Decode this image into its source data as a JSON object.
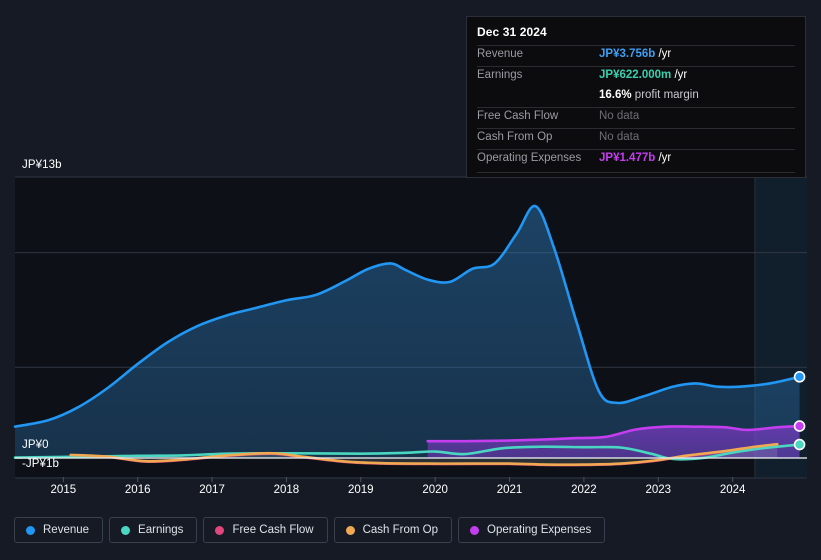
{
  "axes": {
    "y_top_label": "JP¥13b",
    "y_zero_label": "JP¥0",
    "y_bottom_label": "-JP¥1b",
    "x_labels": [
      "2015",
      "2016",
      "2017",
      "2018",
      "2019",
      "2020",
      "2021",
      "2022",
      "2023",
      "2024"
    ]
  },
  "tooltip": {
    "date": "Dec 31 2024",
    "rows": [
      {
        "label": "Revenue",
        "amount": "JP¥3.756b",
        "unit": "/yr",
        "color": "#3e9ff2",
        "nodata": false
      },
      {
        "label": "Earnings",
        "amount": "JP¥622.000m",
        "unit": "/yr",
        "color": "#39cfae",
        "nodata": false
      },
      {
        "label": "",
        "amount": "16.6%",
        "unit": "profit margin",
        "color": "#ffffff",
        "nodata": false
      },
      {
        "label": "Free Cash Flow",
        "amount": "No data",
        "unit": "",
        "color": "#6e6e76",
        "nodata": true
      },
      {
        "label": "Cash From Op",
        "amount": "No data",
        "unit": "",
        "color": "#6e6e76",
        "nodata": true
      },
      {
        "label": "Operating Expenses",
        "amount": "JP¥1.477b",
        "unit": "/yr",
        "color": "#c43ef0",
        "nodata": false
      }
    ]
  },
  "legend": [
    {
      "label": "Revenue",
      "color": "#2196f3"
    },
    {
      "label": "Earnings",
      "color": "#4ad6c0"
    },
    {
      "label": "Free Cash Flow",
      "color": "#e0467c"
    },
    {
      "label": "Cash From Op",
      "color": "#f0a952"
    },
    {
      "label": "Operating Expenses",
      "color": "#c43ef0"
    }
  ],
  "chart_data": {
    "type": "area",
    "title": "",
    "xlabel": "",
    "ylabel": "JP¥",
    "currency": "JP¥",
    "xlim": [
      2014.35,
      2025.0
    ],
    "ylim": [
      -1.0,
      13.0
    ],
    "y_ticks": [
      13,
      9.5,
      4.2,
      0,
      -1
    ],
    "grid": true,
    "legend_position": "bottom",
    "forecast_start": 2024.3,
    "series": [
      {
        "name": "Revenue",
        "color": "#2196f3",
        "fill": true,
        "points": [
          [
            2014.35,
            1.45
          ],
          [
            2014.8,
            1.75
          ],
          [
            2015.2,
            2.35
          ],
          [
            2015.6,
            3.25
          ],
          [
            2016.0,
            4.35
          ],
          [
            2016.4,
            5.35
          ],
          [
            2016.8,
            6.1
          ],
          [
            2017.2,
            6.6
          ],
          [
            2017.6,
            6.95
          ],
          [
            2018.0,
            7.3
          ],
          [
            2018.4,
            7.55
          ],
          [
            2018.8,
            8.2
          ],
          [
            2019.1,
            8.75
          ],
          [
            2019.4,
            9.0
          ],
          [
            2019.6,
            8.7
          ],
          [
            2019.9,
            8.25
          ],
          [
            2020.2,
            8.15
          ],
          [
            2020.5,
            8.75
          ],
          [
            2020.8,
            9.0
          ],
          [
            2021.1,
            10.4
          ],
          [
            2021.35,
            11.65
          ],
          [
            2021.6,
            9.7
          ],
          [
            2021.9,
            6.3
          ],
          [
            2022.2,
            3.1
          ],
          [
            2022.45,
            2.55
          ],
          [
            2022.8,
            2.85
          ],
          [
            2023.2,
            3.3
          ],
          [
            2023.5,
            3.45
          ],
          [
            2023.8,
            3.3
          ],
          [
            2024.1,
            3.3
          ],
          [
            2024.5,
            3.45
          ],
          [
            2024.9,
            3.756
          ]
        ],
        "end_marker": true,
        "end_value": 3.756
      },
      {
        "name": "Earnings",
        "color": "#4ad6c0",
        "fill": false,
        "points": [
          [
            2014.35,
            0.02
          ],
          [
            2015.0,
            0.05
          ],
          [
            2016.0,
            0.1
          ],
          [
            2016.6,
            0.12
          ],
          [
            2017.2,
            0.2
          ],
          [
            2018.0,
            0.22
          ],
          [
            2019.0,
            0.2
          ],
          [
            2019.6,
            0.24
          ],
          [
            2020.0,
            0.3
          ],
          [
            2020.4,
            0.18
          ],
          [
            2020.9,
            0.45
          ],
          [
            2021.4,
            0.52
          ],
          [
            2022.0,
            0.5
          ],
          [
            2022.5,
            0.48
          ],
          [
            2022.9,
            0.2
          ],
          [
            2023.2,
            -0.05
          ],
          [
            2023.6,
            0.0
          ],
          [
            2024.0,
            0.25
          ],
          [
            2024.4,
            0.45
          ],
          [
            2024.9,
            0.622
          ]
        ],
        "end_marker": true,
        "end_value": 0.622
      },
      {
        "name": "Free Cash Flow",
        "color": "#e0467c",
        "fill": false,
        "points": [
          [
            2015.1,
            0.12
          ],
          [
            2015.6,
            0.05
          ],
          [
            2016.1,
            -0.18
          ],
          [
            2016.6,
            -0.1
          ],
          [
            2017.2,
            0.1
          ],
          [
            2017.8,
            0.2
          ],
          [
            2018.2,
            0.05
          ],
          [
            2018.8,
            -0.2
          ],
          [
            2019.3,
            -0.28
          ],
          [
            2019.9,
            -0.3
          ],
          [
            2020.5,
            -0.3
          ],
          [
            2021.0,
            -0.3
          ],
          [
            2021.5,
            -0.35
          ],
          [
            2022.0,
            -0.35
          ],
          [
            2022.5,
            -0.3
          ],
          [
            2023.0,
            -0.12
          ],
          [
            2023.4,
            0.1
          ],
          [
            2023.9,
            0.3
          ],
          [
            2024.3,
            0.5
          ],
          [
            2024.6,
            0.62
          ]
        ],
        "end_marker": false
      },
      {
        "name": "Cash From Op",
        "color": "#f0a952",
        "fill": false,
        "points": [
          [
            2015.1,
            0.14
          ],
          [
            2015.6,
            0.06
          ],
          [
            2016.1,
            -0.16
          ],
          [
            2016.6,
            -0.08
          ],
          [
            2017.2,
            0.12
          ],
          [
            2017.8,
            0.22
          ],
          [
            2018.2,
            0.07
          ],
          [
            2018.8,
            -0.18
          ],
          [
            2019.3,
            -0.26
          ],
          [
            2019.9,
            -0.28
          ],
          [
            2020.5,
            -0.28
          ],
          [
            2021.0,
            -0.28
          ],
          [
            2021.5,
            -0.33
          ],
          [
            2022.0,
            -0.33
          ],
          [
            2022.5,
            -0.28
          ],
          [
            2023.0,
            -0.1
          ],
          [
            2023.4,
            0.12
          ],
          [
            2023.9,
            0.32
          ],
          [
            2024.3,
            0.52
          ],
          [
            2024.6,
            0.64
          ]
        ],
        "end_marker": false
      },
      {
        "name": "Operating Expenses",
        "color": "#c43ef0",
        "fill": true,
        "points": [
          [
            2019.9,
            0.78
          ],
          [
            2020.4,
            0.78
          ],
          [
            2020.9,
            0.8
          ],
          [
            2021.4,
            0.85
          ],
          [
            2021.9,
            0.92
          ],
          [
            2022.3,
            0.98
          ],
          [
            2022.7,
            1.32
          ],
          [
            2023.1,
            1.45
          ],
          [
            2023.5,
            1.45
          ],
          [
            2023.9,
            1.42
          ],
          [
            2024.2,
            1.3
          ],
          [
            2024.6,
            1.42
          ],
          [
            2024.9,
            1.477
          ]
        ],
        "end_marker": true,
        "end_value": 1.477
      }
    ]
  }
}
